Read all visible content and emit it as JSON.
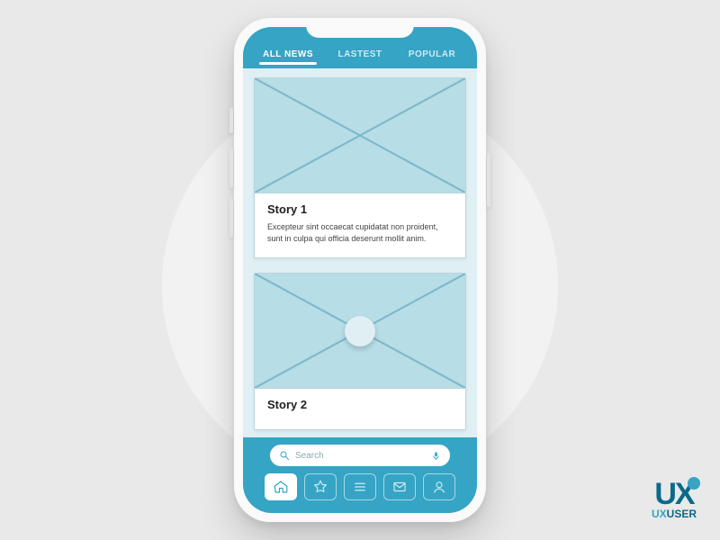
{
  "tabs": [
    {
      "label": "ALL NEWS",
      "name": "tab-all-news",
      "active": true
    },
    {
      "label": "LASTEST",
      "name": "tab-latest",
      "active": false
    },
    {
      "label": "POPULAR",
      "name": "tab-popular",
      "active": false
    }
  ],
  "stories": [
    {
      "title": "Story 1",
      "body": "Excepteur sint occaecat cupidatat non proident, sunt in culpa qui officia deserunt mollit anim."
    },
    {
      "title": "Story 2",
      "body": ""
    }
  ],
  "search": {
    "placeholder": "Search"
  },
  "dock": [
    {
      "name": "home",
      "active": true
    },
    {
      "name": "favorites",
      "active": false
    },
    {
      "name": "menu",
      "active": false
    },
    {
      "name": "mail",
      "active": false
    },
    {
      "name": "profile",
      "active": false
    }
  ],
  "branding": {
    "mark": "UX",
    "line1": "UX",
    "line2": "USER"
  }
}
